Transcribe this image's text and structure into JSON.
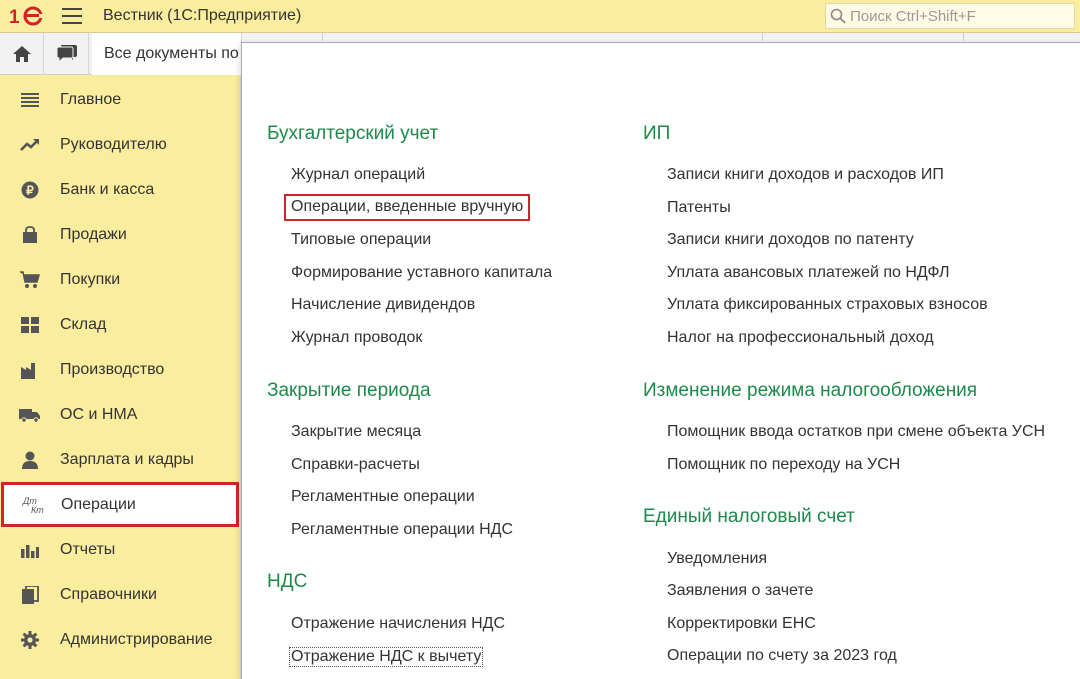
{
  "header": {
    "app_title": "Вестник  (1С:Предприятие)",
    "search_placeholder": "Поиск Ctrl+Shift+F"
  },
  "tabs": {
    "open_tab_label": "Все документы по"
  },
  "sidebar": {
    "items": [
      {
        "label": "Главное",
        "icon": "list-icon"
      },
      {
        "label": "Руководителю",
        "icon": "trend-icon"
      },
      {
        "label": "Банк и касса",
        "icon": "ruble-icon"
      },
      {
        "label": "Продажи",
        "icon": "bag-icon"
      },
      {
        "label": "Покупки",
        "icon": "cart-icon"
      },
      {
        "label": "Склад",
        "icon": "warehouse-icon"
      },
      {
        "label": "Производство",
        "icon": "factory-icon"
      },
      {
        "label": "ОС и НМА",
        "icon": "truck-icon"
      },
      {
        "label": "Зарплата и кадры",
        "icon": "person-icon"
      },
      {
        "label": "Операции",
        "icon": "dt-kt-icon",
        "active": true
      },
      {
        "label": "Отчеты",
        "icon": "bar-chart-icon"
      },
      {
        "label": "Справочники",
        "icon": "books-icon"
      },
      {
        "label": "Администрирование",
        "icon": "gear-icon"
      }
    ]
  },
  "panel": {
    "accounting": {
      "title": "Бухгалтерский учет",
      "links": [
        "Журнал операций",
        "Операции, введенные вручную",
        "Типовые операции",
        "Формирование уставного капитала",
        "Начисление дивидендов",
        "Журнал проводок"
      ]
    },
    "period_close": {
      "title": "Закрытие периода",
      "links": [
        "Закрытие месяца",
        "Справки-расчеты",
        "Регламентные операции",
        "Регламентные операции НДС"
      ]
    },
    "vat": {
      "title": "НДС",
      "links": [
        "Отражение начисления НДС",
        "Отражение НДС к вычету"
      ]
    },
    "ip": {
      "title": "ИП",
      "links": [
        "Записи книги доходов и расходов ИП",
        "Патенты",
        "Записи книги доходов по патенту",
        "Уплата авансовых платежей по НДФЛ",
        "Уплата фиксированных страховых взносов",
        "Налог на профессиональный доход"
      ]
    },
    "tax_regime": {
      "title": "Изменение режима налогообложения",
      "links": [
        "Помощник ввода остатков при смене объекта УСН",
        "Помощник по переходу на УСН"
      ]
    },
    "ens": {
      "title": "Единый налоговый счет",
      "links": [
        "Уведомления",
        "Заявления о зачете",
        "Корректировки ЕНС",
        "Операции по счету за 2023 год"
      ]
    }
  },
  "colors": {
    "sidebar_bg": "#fbed9e",
    "section_title": "#1d8a4b",
    "highlight": "#d1232a"
  }
}
